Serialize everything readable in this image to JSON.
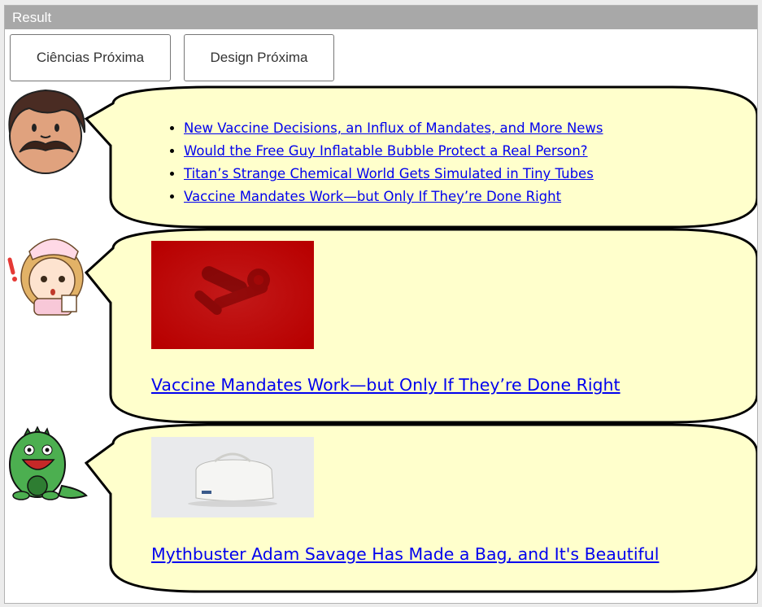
{
  "window": {
    "title": "Result"
  },
  "buttons": {
    "ciencias": "Ciências Próxima",
    "design": "Design Próxima"
  },
  "bubble1": {
    "links": [
      "New Vaccine Decisions, an Influx of Mandates, and More News",
      "Would the Free Guy Inflatable Bubble Protect a Real Person?",
      "Titan’s Strange Chemical World Gets Simulated in Tiny Tubes",
      "Vaccine Mandates Work—but Only If They’re Done Right"
    ]
  },
  "bubble2": {
    "link": "Vaccine Mandates Work—but Only If They’re Done Right"
  },
  "bubble3": {
    "link": "Mythbuster Adam Savage Has Made a Bag, and It's Beautiful"
  },
  "colors": {
    "bubble_fill": "#ffffcc",
    "title_bar": "#a8a8a8",
    "link": "#0000ee"
  },
  "icons": [
    "mustache-man-avatar",
    "nurse-avatar",
    "green-monster-avatar"
  ]
}
